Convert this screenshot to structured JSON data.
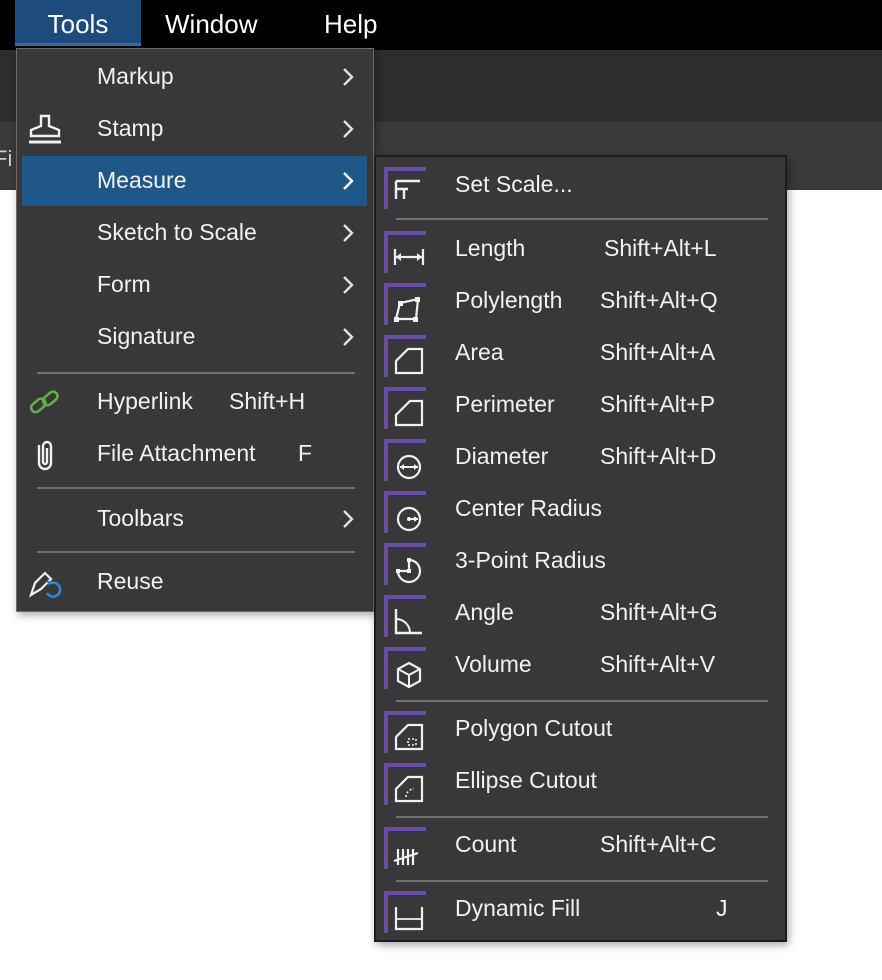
{
  "menubar": {
    "items": [
      {
        "label": "Tools"
      },
      {
        "label": "Window"
      },
      {
        "label": "Help"
      }
    ]
  },
  "background": {
    "tab_label": "Fi"
  },
  "colors": {
    "menu_bg": "#383838",
    "active_bg": "#205789",
    "menubar_bg": "#000000",
    "measure_icon_accent": "#6b4fa3",
    "hyperlink_icon": "#5fb04a",
    "reuse_icon_accent": "#2f86d6"
  },
  "tools_menu": {
    "items": [
      {
        "label": "Markup",
        "has_submenu": true,
        "icon": ""
      },
      {
        "label": "Stamp",
        "has_submenu": true,
        "icon": "stamp-icon"
      },
      {
        "label": "Measure",
        "has_submenu": true,
        "icon": "",
        "active": true
      },
      {
        "label": "Sketch to Scale",
        "has_submenu": true,
        "icon": ""
      },
      {
        "label": "Form",
        "has_submenu": true,
        "icon": ""
      },
      {
        "label": "Signature",
        "has_submenu": true,
        "icon": ""
      },
      {
        "label": "Hyperlink",
        "shortcut": "Shift+H",
        "icon": "hyperlink-icon"
      },
      {
        "label": "File Attachment",
        "shortcut": "F",
        "icon": "paperclip-icon"
      },
      {
        "label": "Toolbars",
        "has_submenu": true,
        "icon": ""
      },
      {
        "label": "Reuse",
        "icon": "reuse-icon"
      }
    ]
  },
  "measure_menu": {
    "items": [
      {
        "label": "Set Scale...",
        "shortcut": "",
        "icon": "set-scale-icon"
      },
      {
        "label": "Length",
        "shortcut": "Shift+Alt+L",
        "icon": "length-icon"
      },
      {
        "label": "Polylength",
        "shortcut": "Shift+Alt+Q",
        "icon": "polylength-icon"
      },
      {
        "label": "Area",
        "shortcut": "Shift+Alt+A",
        "icon": "area-icon"
      },
      {
        "label": "Perimeter",
        "shortcut": "Shift+Alt+P",
        "icon": "perimeter-icon"
      },
      {
        "label": "Diameter",
        "shortcut": "Shift+Alt+D",
        "icon": "diameter-icon"
      },
      {
        "label": "Center Radius",
        "shortcut": "",
        "icon": "center-radius-icon"
      },
      {
        "label": "3-Point Radius",
        "shortcut": "",
        "icon": "three-point-radius-icon"
      },
      {
        "label": "Angle",
        "shortcut": "Shift+Alt+G",
        "icon": "angle-icon"
      },
      {
        "label": "Volume",
        "shortcut": "Shift+Alt+V",
        "icon": "volume-icon"
      },
      {
        "label": "Polygon Cutout",
        "shortcut": "",
        "icon": "polygon-cutout-icon"
      },
      {
        "label": "Ellipse Cutout",
        "shortcut": "",
        "icon": "ellipse-cutout-icon"
      },
      {
        "label": "Count",
        "shortcut": "Shift+Alt+C",
        "icon": "count-icon"
      },
      {
        "label": "Dynamic Fill",
        "shortcut": "J",
        "icon": "dynamic-fill-icon"
      }
    ]
  }
}
